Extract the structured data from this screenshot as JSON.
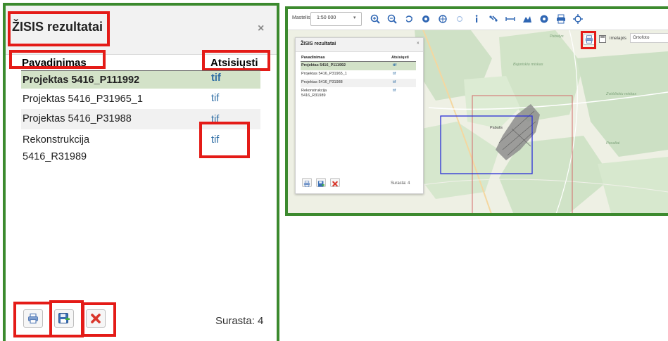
{
  "left_panel": {
    "title": "ŽISIS rezultatai",
    "close_symbol": "×",
    "columns": {
      "name": "Pavadinimas",
      "download": "Atsisiųsti"
    },
    "rows": [
      {
        "name": "Projektas 5416_P111992",
        "download": "tif",
        "selected": true
      },
      {
        "name": "Projektas 5416_P31965_1",
        "download": "tif",
        "selected": false
      },
      {
        "name": "Projektas 5416_P31988",
        "download": "tif",
        "selected": false
      },
      {
        "name_line1": "Rekonstrukcija",
        "name_line2": "5416_R31989",
        "download": "tif",
        "selected": false
      }
    ],
    "buttons": [
      {
        "icon": "printer-icon"
      },
      {
        "icon": "save-export-icon"
      },
      {
        "icon": "delete-x-icon"
      }
    ],
    "count_text": "Surasta: 4"
  },
  "map_view": {
    "toolbar": {
      "scale_label": "Mastelis",
      "scale_value": "1:50 000",
      "tools": [
        "zoom-in-icon",
        "zoom-out-icon",
        "lasso-icon",
        "locate-icon",
        "globe-icon",
        "dot-icon",
        "info-icon",
        "link-icon",
        "measure-line-icon",
        "measure-area-icon",
        "layers-icon",
        "print-icon",
        "crosshair-icon"
      ]
    },
    "sub_toolbar": {
      "save_label": "imelapis",
      "basemap_label": "Ortofoto"
    },
    "mini_panel": {
      "title": "ŽISIS rezultatai",
      "close_symbol": "×",
      "columns": {
        "name": "Pavadinimas",
        "download": "Atsisiųsti"
      },
      "rows": [
        {
          "name": "Projektas 5416_P111992",
          "download": "tif"
        },
        {
          "name": "Projektas 5416_P31965_1",
          "download": "tif"
        },
        {
          "name": "Projektas 5416_P31988",
          "download": "tif"
        },
        {
          "name_line1": "Rekonstrukcija",
          "name_line2": "5416_R31989",
          "download": "tif"
        }
      ],
      "count_text": "Surasta: 4"
    },
    "map_labels": [
      "Pabalys",
      "Pabulis",
      "Bajoriskiu miskas",
      "Zvirbliskiu miskas",
      "Pasaliai"
    ]
  },
  "colors": {
    "frame": "#3c8a2e",
    "highlight_box": "#e41b17",
    "selected_row": "#d3e2c8",
    "link": "#2e6da4",
    "extent_blue": "#2a2fd8",
    "extent_red": "#d46a6a"
  }
}
